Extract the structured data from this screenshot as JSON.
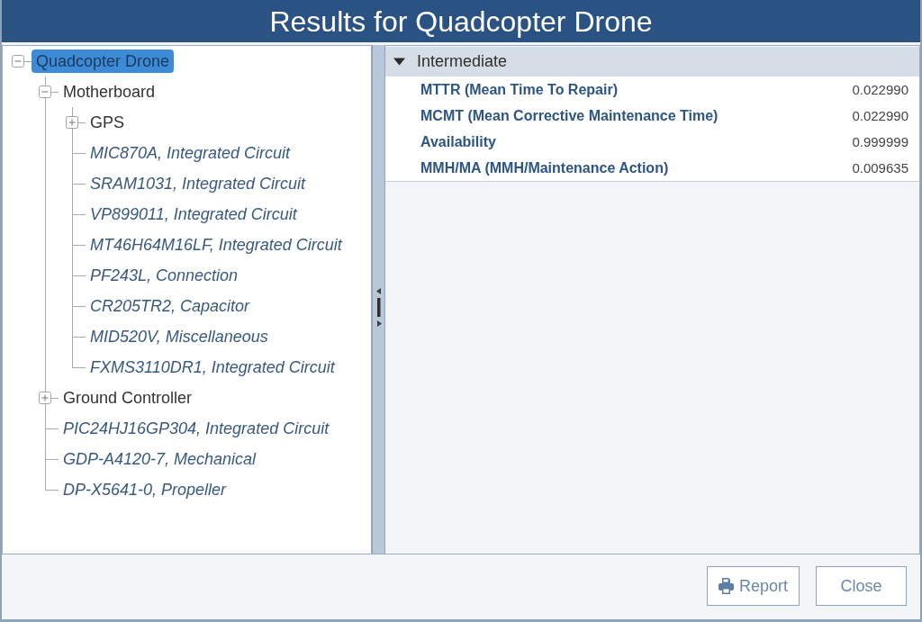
{
  "window": {
    "title": "Results for Quadcopter Drone"
  },
  "tree": [
    {
      "label": "Quadcopter Drone",
      "kind": "group",
      "expanded": true,
      "selected": true,
      "children": [
        {
          "label": "Motherboard",
          "kind": "group",
          "expanded": true,
          "selected": false,
          "children": [
            {
              "label": "GPS",
              "kind": "group",
              "expanded": false,
              "selected": false
            },
            {
              "label": "MIC870A, Integrated Circuit",
              "kind": "part",
              "selected": false
            },
            {
              "label": "SRAM1031, Integrated Circuit",
              "kind": "part",
              "selected": false
            },
            {
              "label": "VP899011, Integrated Circuit",
              "kind": "part",
              "selected": false
            },
            {
              "label": "MT46H64M16LF, Integrated Circuit",
              "kind": "part",
              "selected": false
            },
            {
              "label": "PF243L, Connection",
              "kind": "part",
              "selected": false
            },
            {
              "label": "CR205TR2, Capacitor",
              "kind": "part",
              "selected": false
            },
            {
              "label": "MID520V, Miscellaneous",
              "kind": "part",
              "selected": false
            },
            {
              "label": "FXMS3110DR1, Integrated Circuit",
              "kind": "part",
              "selected": false
            }
          ]
        },
        {
          "label": "Ground Controller",
          "kind": "group",
          "expanded": false,
          "selected": false
        },
        {
          "label": "PIC24HJ16GP304, Integrated Circuit",
          "kind": "part",
          "selected": false
        },
        {
          "label": "GDP-A4120-7, Mechanical",
          "kind": "part",
          "selected": false
        },
        {
          "label": "DP-X5641-0, Propeller",
          "kind": "part",
          "selected": false
        }
      ]
    }
  ],
  "results": {
    "sections": [
      {
        "title": "Intermediate",
        "expanded": true,
        "rows": [
          {
            "label": "MTTR (Mean Time To Repair)",
            "value": "0.022990"
          },
          {
            "label": "MCMT (Mean Corrective Maintenance Time)",
            "value": "0.022990"
          },
          {
            "label": "Availability",
            "value": "0.999999"
          },
          {
            "label": "MMH/MA (MMH/Maintenance Action)",
            "value": "0.009635"
          }
        ]
      }
    ]
  },
  "buttons": [
    {
      "label": "Report",
      "kind": "print"
    },
    {
      "label": "Close",
      "kind": "close"
    }
  ]
}
